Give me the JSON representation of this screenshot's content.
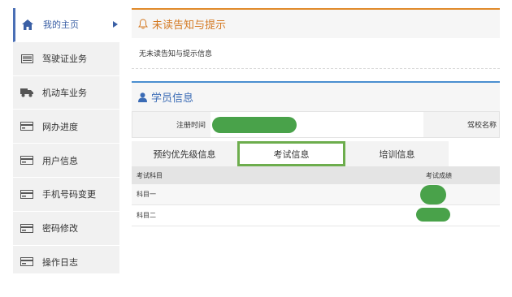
{
  "sidebar": {
    "items": [
      {
        "label": "我的主页",
        "icon": "home-icon",
        "active": true
      },
      {
        "label": "驾驶证业务",
        "icon": "id-card-icon",
        "active": false
      },
      {
        "label": "机动车业务",
        "icon": "truck-icon",
        "active": false
      },
      {
        "label": "网办进度",
        "icon": "progress-card-icon",
        "active": false
      },
      {
        "label": "用户信息",
        "icon": "card-icon",
        "active": false
      },
      {
        "label": "手机号码变更",
        "icon": "card-icon",
        "active": false
      },
      {
        "label": "密码修改",
        "icon": "card-icon",
        "active": false
      },
      {
        "label": "操作日志",
        "icon": "card-icon",
        "active": false
      }
    ]
  },
  "notice": {
    "title": "未读告知与提示",
    "empty_text": "无未读告知与提示信息"
  },
  "student": {
    "title": "学员信息",
    "reg_time_label": "注册时间",
    "school_label": "驾校名称",
    "tabs": [
      {
        "label": "预约优先级信息"
      },
      {
        "label": "考试信息",
        "selected": true
      },
      {
        "label": "培训信息"
      }
    ],
    "exam": {
      "headers": [
        "考试科目",
        "考试成绩"
      ],
      "rows": [
        {
          "subject": "科目一"
        },
        {
          "subject": "科目二"
        }
      ]
    }
  },
  "colors": {
    "notice_accent": "#d47a24",
    "student_accent": "#3a6bb5",
    "active_nav": "#3a5fa5",
    "tab_highlight": "#6dad4d",
    "redaction": "#49a24a"
  }
}
